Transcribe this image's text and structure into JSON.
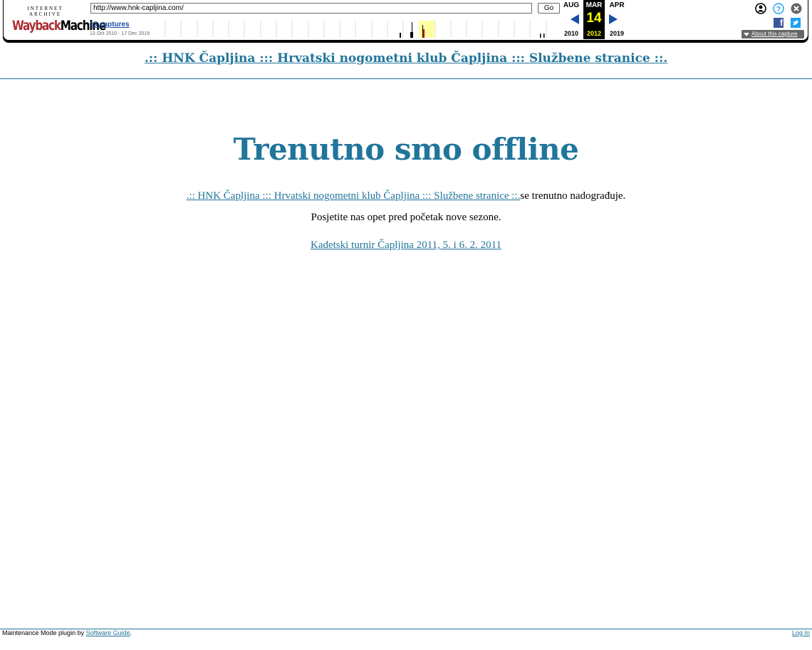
{
  "wayback": {
    "logo_top": "INTERNET ARCHIVE",
    "logo_word1": "Wayback",
    "logo_word2": "Machine",
    "url": "http://www.hnk-capljina.com/",
    "go_label": "Go",
    "captures_label": "13 captures",
    "captures_range": "13 Oct 2010 - 17 Dec 2019",
    "prev_month": "AUG",
    "prev_year": "2010",
    "current_month": "MAR",
    "current_day": "14",
    "current_year": "2012",
    "next_month": "APR",
    "next_year": "2019",
    "about_label": "About this capture",
    "colors": {
      "link": "#1a4fa3",
      "highlight": "#ffff00",
      "logo_red": "#ab2e33"
    }
  },
  "site": {
    "title": ".:: HNK Čapljina ::: Hrvatski nogometni klub Čapljina ::: Službene stranice ::.",
    "heading": "Trenutno smo offline",
    "line1_link": ".:: HNK Čapljina ::: Hrvatski nogometni klub Čapljina ::: Službene stranice ::.",
    "line1_text": "se trenutno nadograđuje.",
    "line2": "Posjetite nas opet pred početak nove sezone.",
    "line3_link": "Kadetski turnir Čapljina 2011, 5. i 6. 2. 2011",
    "accent": "#21759b"
  },
  "footer": {
    "left_text": "Maintenance Mode plugin by ",
    "left_link": "Software Guide",
    "left_suffix": ".",
    "right_link": "Log In"
  },
  "icons": {
    "user": "user-circle-icon",
    "help": "help-icon",
    "close": "close-icon",
    "facebook": "facebook-icon",
    "twitter": "twitter-icon"
  }
}
